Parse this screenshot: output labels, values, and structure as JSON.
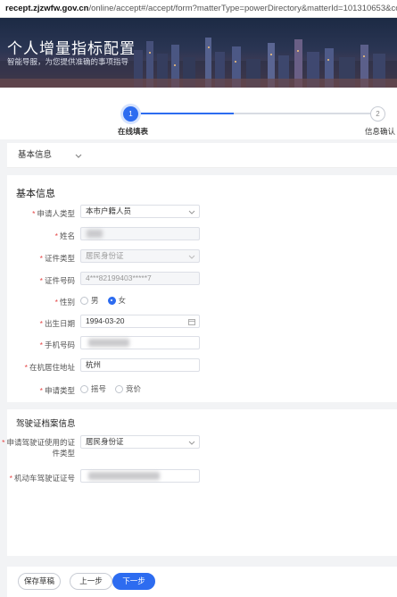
{
  "browser": {
    "url_host": "recept.zjzwfw.gov.cn",
    "url_path": "/online/accept#/accept/form?matterType=powerDirectory&matterId=101310653&config=%7"
  },
  "banner": {
    "title": "个人增量指标配置",
    "subtitle": "智能导服，为您提供准确的事项指导"
  },
  "steps": [
    {
      "number": "1",
      "label": "在线填表",
      "active": true
    },
    {
      "number": "2",
      "label": "信息确认",
      "active": false
    }
  ],
  "tabs": {
    "active_label": "基本信息"
  },
  "basic": {
    "section_title": "基本信息",
    "fields": {
      "applicant_type": {
        "label": "申请人类型",
        "value": "本市户籍人员"
      },
      "name": {
        "label": "姓名"
      },
      "id_type": {
        "label": "证件类型",
        "value": "居民身份证"
      },
      "id_number": {
        "label": "证件号码",
        "value": "4***82199403*****7"
      },
      "gender": {
        "label": "性别",
        "options": [
          "男",
          "女"
        ],
        "selected": "女"
      },
      "birth_date": {
        "label": "出生日期",
        "value": "1994-03-20"
      },
      "phone": {
        "label": "手机号码"
      },
      "residence": {
        "label": "在杭居住地址",
        "value": "杭州"
      },
      "apply_type": {
        "label": "申请类型",
        "options": [
          "摇号",
          "竞价"
        ]
      }
    }
  },
  "license": {
    "section_title": "驾驶证档案信息",
    "fields": {
      "cert_type": {
        "label_line1": "申请驾驶证使用的证",
        "label_line2": "件类型",
        "value": "居民身份证"
      },
      "license_no": {
        "label": "机动车驾驶证证号"
      }
    }
  },
  "footer": {
    "save_label": "保存草稿",
    "prev_label": "上一步",
    "next_label": "下一步"
  },
  "colors": {
    "primary": "#2d6cf0",
    "required": "#e54545"
  }
}
